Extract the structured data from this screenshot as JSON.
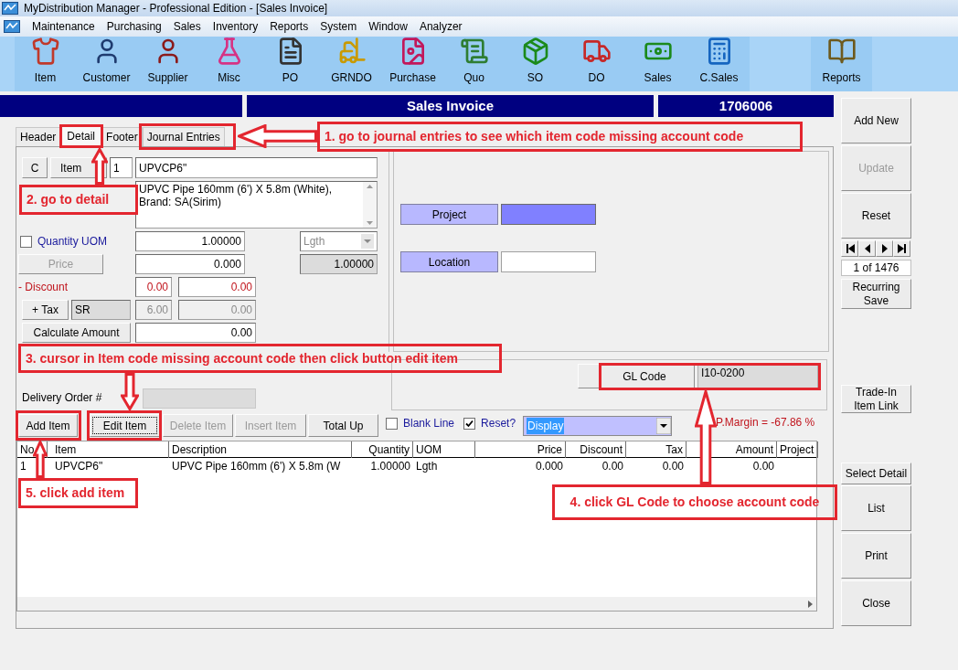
{
  "window": {
    "title": "MyDistribution Manager - Professional Edition - [Sales Invoice]"
  },
  "menu": [
    "Maintenance",
    "Purchasing",
    "Sales",
    "Inventory",
    "Reports",
    "System",
    "Window",
    "Analyzer"
  ],
  "toolbar": [
    {
      "label": "Item",
      "kind": "item"
    },
    {
      "label": "Customer",
      "kind": "customer"
    },
    {
      "label": "Supplier",
      "kind": "supplier"
    },
    {
      "label": "Misc",
      "kind": "misc"
    },
    {
      "label": "PO",
      "kind": "po"
    },
    {
      "label": "GRNDO",
      "kind": "grndo"
    },
    {
      "label": "Purchase",
      "kind": "purchase"
    },
    {
      "label": "Quo",
      "kind": "quo"
    },
    {
      "label": "SO",
      "kind": "so"
    },
    {
      "label": "DO",
      "kind": "do"
    },
    {
      "label": "Sales",
      "kind": "sales"
    },
    {
      "label": "C.Sales",
      "kind": "csales"
    },
    {
      "label": "Reports",
      "kind": "reports"
    }
  ],
  "header": {
    "title": "Sales Invoice",
    "number": "1706006"
  },
  "tabs": [
    {
      "label": "Header",
      "selected": false
    },
    {
      "label": "Detail",
      "selected": true
    },
    {
      "label": "Footer",
      "selected": false
    },
    {
      "label": "Journal Entries",
      "selected": false
    }
  ],
  "detail": {
    "c_button": "C",
    "item_button": "Item",
    "line_no": "1",
    "item_code": "UPVCP6\"",
    "description": "UPVC Pipe 160mm (6') X 5.8m (White), Brand: SA(Sirim)",
    "quantity_uom": {
      "label": "Quantity UOM",
      "checked": false
    },
    "quantity": "1.00000",
    "uom": {
      "value": "Lgth",
      "disabled": true
    },
    "price_button": {
      "label": "Price",
      "disabled": true
    },
    "price": "0.000",
    "uom_rate": "1.00000",
    "discount_label": "- Discount",
    "discount_pct": "0.00",
    "discount_amount": "0.00",
    "tax_button": "+ Tax",
    "tax_code": "SR",
    "tax_rate": "6.00",
    "tax_amount": "0.00",
    "calc_button": "Calculate Amount",
    "amount": "0.00",
    "project_label": "Project",
    "location_label": "Location",
    "delivery_order_label": "Delivery Order #",
    "gl_code_button": "GL Code",
    "gl_code": "I10-0200"
  },
  "line_buttons": [
    {
      "label": "Add Item",
      "disabled": false,
      "focused": false
    },
    {
      "label": "Edit Item",
      "disabled": false,
      "focused": true
    },
    {
      "label": "Delete Item",
      "disabled": true,
      "focused": false
    },
    {
      "label": "Insert Item",
      "disabled": true,
      "focused": false
    },
    {
      "label": "Total Up",
      "disabled": false,
      "focused": false
    }
  ],
  "options": [
    {
      "label": "Blank Line",
      "checked": false
    },
    {
      "label": "Reset?",
      "checked": true
    }
  ],
  "display_select": {
    "value": "Display"
  },
  "margin": "P.Margin = -67.86 %",
  "table": {
    "columns": [
      "No",
      "Item",
      "Description",
      "Quantity",
      "UOM",
      "Price",
      "Discount",
      "Tax",
      "Amount",
      "Project"
    ],
    "rows": [
      [
        "1",
        "UPVCP6\"",
        "UPVC Pipe 160mm (6') X 5.8m (W",
        "1.00000",
        "Lgth",
        "0.000",
        "0.00",
        "0.00",
        "0.00",
        null
      ]
    ]
  },
  "side": {
    "top": [
      {
        "label": "Add New",
        "disabled": false
      },
      {
        "label": "Update",
        "disabled": true
      },
      {
        "label": "Reset",
        "disabled": false
      }
    ],
    "record": "1 of 1476",
    "bottom": [
      {
        "label": "Recurring Save",
        "disabled": false
      },
      {
        "label": "Trade-In Item Link",
        "disabled": false
      },
      {
        "label": "Select Detail",
        "disabled": false
      },
      {
        "label": "List",
        "disabled": false
      },
      {
        "label": "Print",
        "disabled": false
      },
      {
        "label": "Close",
        "disabled": false
      }
    ]
  },
  "annotations": [
    "1. go to journal entries to see which item code missing account code",
    "2. go to detail",
    "3. cursor in Item code missing account code then click button edit item",
    "4. click GL Code to choose account code",
    "5. click add item"
  ]
}
